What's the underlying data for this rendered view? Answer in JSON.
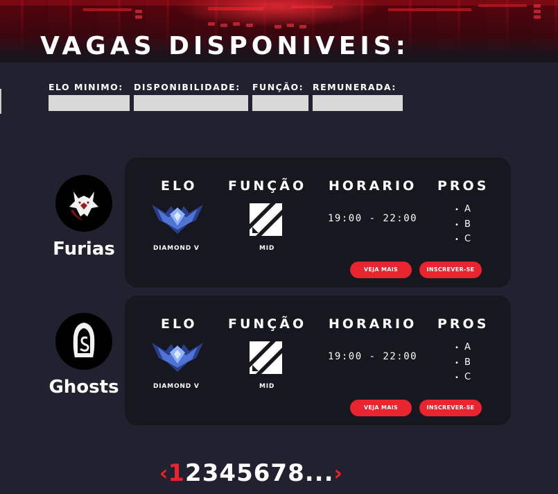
{
  "page": {
    "title": "VAGAS DISPONIVEIS:"
  },
  "filters": [
    {
      "label": "ELO MINIMO:",
      "value": ""
    },
    {
      "label": "DISPONIBILIDADE:",
      "value": ""
    },
    {
      "label": "FUNÇÃO:",
      "value": ""
    },
    {
      "label": "REMUNERADA:",
      "value": ""
    }
  ],
  "column_headers": {
    "elo": "ELO",
    "funcao": "FUNÇÃO",
    "horario": "HORARIO",
    "pros": "PROS"
  },
  "listings": [
    {
      "team": "Furias",
      "logo_icon": "white-wolf-logo",
      "elo": "DIAMOND V",
      "elo_icon": "diamond-rank-emblem-icon",
      "role": "MID",
      "role_icon": "mid-lane-icon",
      "horario": "19:00 - 22:00",
      "pros": [
        "A",
        "B",
        "C"
      ],
      "more_button": "VEJA MAIS",
      "apply_button": "INSCREVER-SE"
    },
    {
      "team": "Ghosts",
      "logo_icon": "hooded-ghost-logo",
      "elo": "DIAMOND V",
      "elo_icon": "diamond-rank-emblem-icon",
      "role": "MID",
      "role_icon": "mid-lane-icon",
      "horario": "19:00 - 22:00",
      "pros": [
        "A",
        "B",
        "C"
      ],
      "more_button": "VEJA MAIS",
      "apply_button": "INSCREVER-SE"
    }
  ],
  "pagination": {
    "prev": "‹",
    "next": "›",
    "pages": [
      "1",
      "2",
      "3",
      "4",
      "5",
      "6",
      "7",
      "8"
    ],
    "ellipsis": "...",
    "current": "1"
  },
  "colors": {
    "background": "#22212f",
    "card": "#171720",
    "accent": "#e8242f",
    "input": "#d9d9d9"
  }
}
